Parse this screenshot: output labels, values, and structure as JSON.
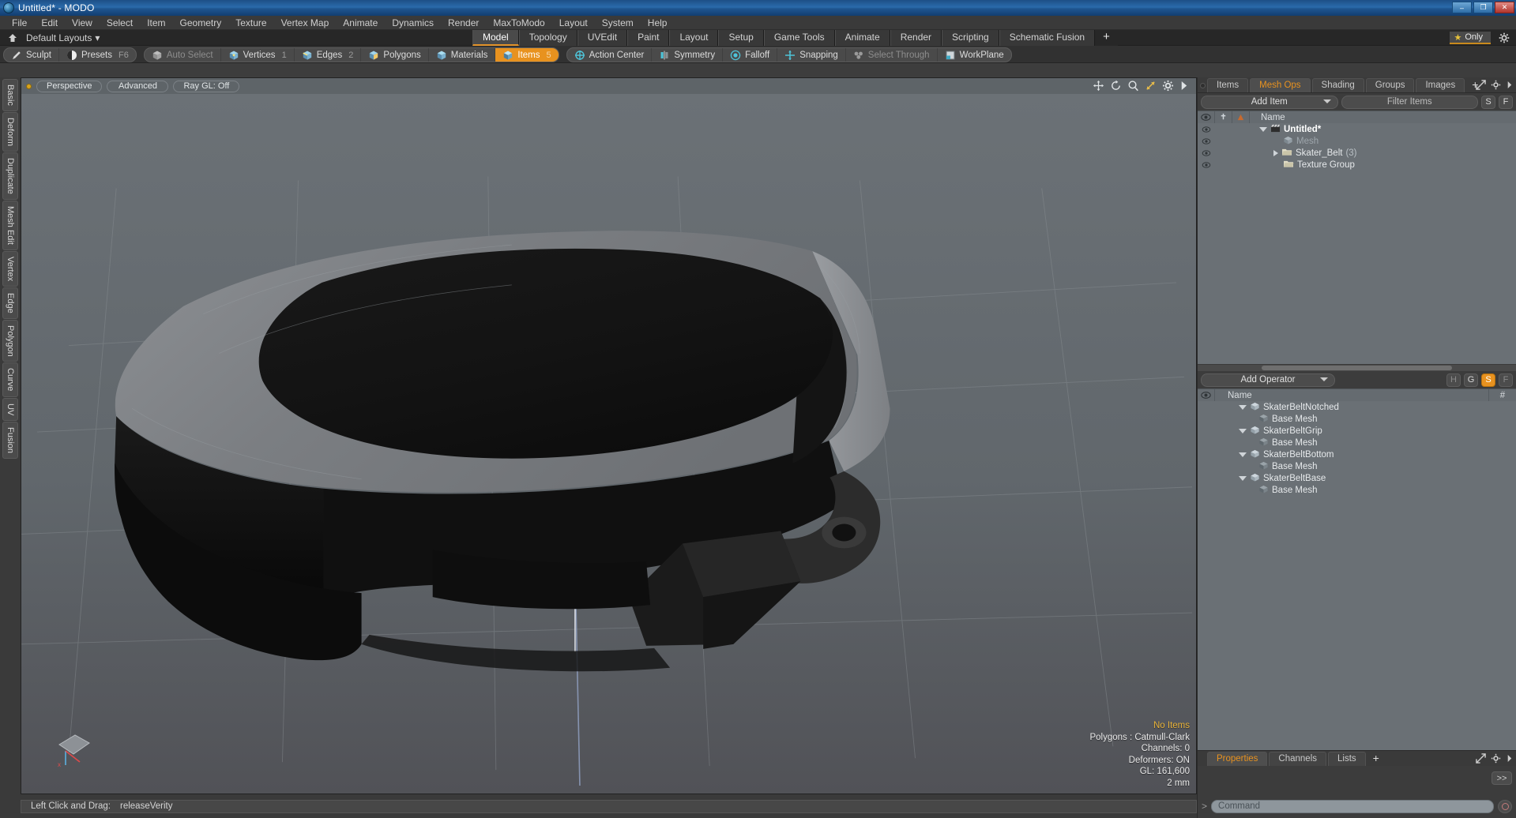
{
  "window": {
    "title": "Untitled* - MODO",
    "app_icon": "modo-logo-icon",
    "buttons": {
      "minimize": "–",
      "maximize": "❐",
      "close": "✕"
    }
  },
  "menubar": {
    "items": [
      "File",
      "Edit",
      "View",
      "Select",
      "Item",
      "Geometry",
      "Texture",
      "Vertex Map",
      "Animate",
      "Dynamics",
      "Render",
      "MaxToModo",
      "Layout",
      "System",
      "Help"
    ]
  },
  "layoutbar": {
    "home_icon": "home-icon",
    "default_layouts": "Default Layouts",
    "dropdown_caret": "▾",
    "tabs": [
      {
        "label": "Model",
        "active": true
      },
      {
        "label": "Topology",
        "active": false
      },
      {
        "label": "UVEdit",
        "active": false
      },
      {
        "label": "Paint",
        "active": false
      },
      {
        "label": "Layout",
        "active": false
      },
      {
        "label": "Setup",
        "active": false
      },
      {
        "label": "Game Tools",
        "active": false
      },
      {
        "label": "Animate",
        "active": false
      },
      {
        "label": "Render",
        "active": false
      },
      {
        "label": "Scripting",
        "active": false
      },
      {
        "label": "Schematic Fusion",
        "active": false
      }
    ],
    "add_tab": "+",
    "only_button": {
      "label": "Only",
      "icon": "star-icon"
    },
    "settings_icon": "gear-icon"
  },
  "modebar": {
    "group1": [
      {
        "label": "Sculpt",
        "icon": "pencil-icon",
        "state": "normal",
        "num": ""
      },
      {
        "label": "Presets",
        "icon": "sphere-icon",
        "state": "normal",
        "num": "F6"
      }
    ],
    "group2": [
      {
        "label": "Auto Select",
        "icon": "cube-grey-icon",
        "state": "disabled",
        "num": ""
      },
      {
        "label": "Vertices",
        "icon": "cube-vertex-icon",
        "state": "normal",
        "num": "1"
      },
      {
        "label": "Edges",
        "icon": "cube-edge-icon",
        "state": "normal",
        "num": "2"
      },
      {
        "label": "Polygons",
        "icon": "cube-poly-icon",
        "state": "normal",
        "num": ""
      },
      {
        "label": "Materials",
        "icon": "cube-material-icon",
        "state": "normal",
        "num": ""
      },
      {
        "label": "Items",
        "icon": "cube-item-icon",
        "state": "selected",
        "num": "5"
      }
    ],
    "group3": [
      {
        "label": "Action Center",
        "icon": "action-center-icon",
        "state": "normal",
        "num": ""
      },
      {
        "label": "Symmetry",
        "icon": "symmetry-icon",
        "state": "normal",
        "num": ""
      },
      {
        "label": "Falloff",
        "icon": "falloff-icon",
        "state": "normal",
        "num": ""
      },
      {
        "label": "Snapping",
        "icon": "snapping-icon",
        "state": "normal",
        "num": ""
      },
      {
        "label": "Select Through",
        "icon": "select-through-icon",
        "state": "disabled",
        "num": ""
      },
      {
        "label": "WorkPlane",
        "icon": "workplane-icon",
        "state": "normal",
        "num": ""
      }
    ]
  },
  "left_tabs": [
    "Basic",
    "Deform",
    "Duplicate",
    "Mesh Edit",
    "Vertex",
    "Edge",
    "Polygon",
    "Curve",
    "UV",
    "Fusion"
  ],
  "viewport": {
    "header": {
      "pills": [
        "Perspective",
        "Advanced",
        "Ray GL: Off"
      ],
      "icons": [
        "move-icon",
        "rotate-icon",
        "zoom-icon",
        "fit-icon",
        "gear-icon",
        "play-icon"
      ]
    },
    "stats": [
      {
        "text": "No Items",
        "highlight": true
      },
      {
        "text": "Polygons : Catmull-Clark",
        "highlight": false
      },
      {
        "text": "Channels: 0",
        "highlight": false
      },
      {
        "text": "Deformers: ON",
        "highlight": false
      },
      {
        "text": "GL: 161,600",
        "highlight": false
      },
      {
        "text": "2 mm",
        "highlight": false
      }
    ],
    "gizmo": "axis-gizmo-icon"
  },
  "items_panel": {
    "tabs": [
      {
        "label": "Items",
        "active": false
      },
      {
        "label": "Mesh Ops",
        "active": true
      },
      {
        "label": "Shading",
        "active": false
      },
      {
        "label": "Groups",
        "active": false
      },
      {
        "label": "Images",
        "active": false
      }
    ],
    "add_tab": "+",
    "right_icons": [
      "expand-icon",
      "gear-icon",
      "chevron-right-icon"
    ],
    "add_item_button": "Add Item",
    "filter_placeholder": "Filter Items",
    "filter_buttons": [
      "S",
      "F"
    ],
    "columns": [
      "eye-icon",
      "lock-icon",
      "render-icon",
      "Name"
    ],
    "rows": [
      {
        "name": "Untitled*",
        "indent": 0,
        "bold": true,
        "dim": false,
        "twirl": "down",
        "icon": "scene-icon",
        "count": ""
      },
      {
        "name": "Mesh",
        "indent": 1,
        "bold": false,
        "dim": true,
        "twirl": "none",
        "icon": "mesh-icon",
        "count": ""
      },
      {
        "name": "Skater_Belt",
        "indent": 1,
        "bold": false,
        "dim": false,
        "twirl": "right",
        "icon": "folder-icon",
        "count": "(3)"
      },
      {
        "name": "Texture Group",
        "indent": 1,
        "bold": false,
        "dim": false,
        "twirl": "none",
        "icon": "folder-icon",
        "count": ""
      }
    ]
  },
  "ops_panel": {
    "add_operator_button": "Add Operator",
    "toggles": [
      {
        "label": "H",
        "on": false,
        "dim": true
      },
      {
        "label": "G",
        "on": false,
        "dim": false
      },
      {
        "label": "S",
        "on": true,
        "dim": false
      },
      {
        "label": "F",
        "on": false,
        "dim": true
      }
    ],
    "columns": [
      "eye-icon",
      "Name",
      "#"
    ],
    "rows": [
      {
        "name": "SkaterBeltNotched",
        "indent": 0,
        "twirl": "down",
        "icon": "mesh-op-icon"
      },
      {
        "name": "Base Mesh",
        "indent": 1,
        "twirl": "none",
        "icon": "mesh-icon"
      },
      {
        "name": "SkaterBeltGrip",
        "indent": 0,
        "twirl": "down",
        "icon": "mesh-op-icon"
      },
      {
        "name": "Base Mesh",
        "indent": 1,
        "twirl": "none",
        "icon": "mesh-icon"
      },
      {
        "name": "SkaterBeltBottom",
        "indent": 0,
        "twirl": "down",
        "icon": "mesh-op-icon"
      },
      {
        "name": "Base Mesh",
        "indent": 1,
        "twirl": "none",
        "icon": "mesh-icon"
      },
      {
        "name": "SkaterBeltBase",
        "indent": 0,
        "twirl": "down",
        "icon": "mesh-op-icon"
      },
      {
        "name": "Base Mesh",
        "indent": 1,
        "twirl": "none",
        "icon": "mesh-icon"
      }
    ]
  },
  "properties_panel": {
    "tabs": [
      {
        "label": "Properties",
        "active": true
      },
      {
        "label": "Channels",
        "active": false
      },
      {
        "label": "Lists",
        "active": false
      }
    ],
    "add_tab": "+",
    "right_icons": [
      "expand-icon",
      "gear-icon",
      "chevron-right-icon"
    ],
    "expand_button": ">>"
  },
  "statusbar": {
    "hint_label": "Left Click and Drag:",
    "hint_value": "releaseVerity"
  },
  "command": {
    "prompt": ">",
    "placeholder": "Command",
    "record_icon": "record-icon"
  },
  "colors": {
    "accent": "#e8921f",
    "title_blue": "#2a6bab",
    "panel_bg": "#3c3c3c",
    "list_bg": "#6a7075",
    "viewport_bg": "#62686d"
  }
}
